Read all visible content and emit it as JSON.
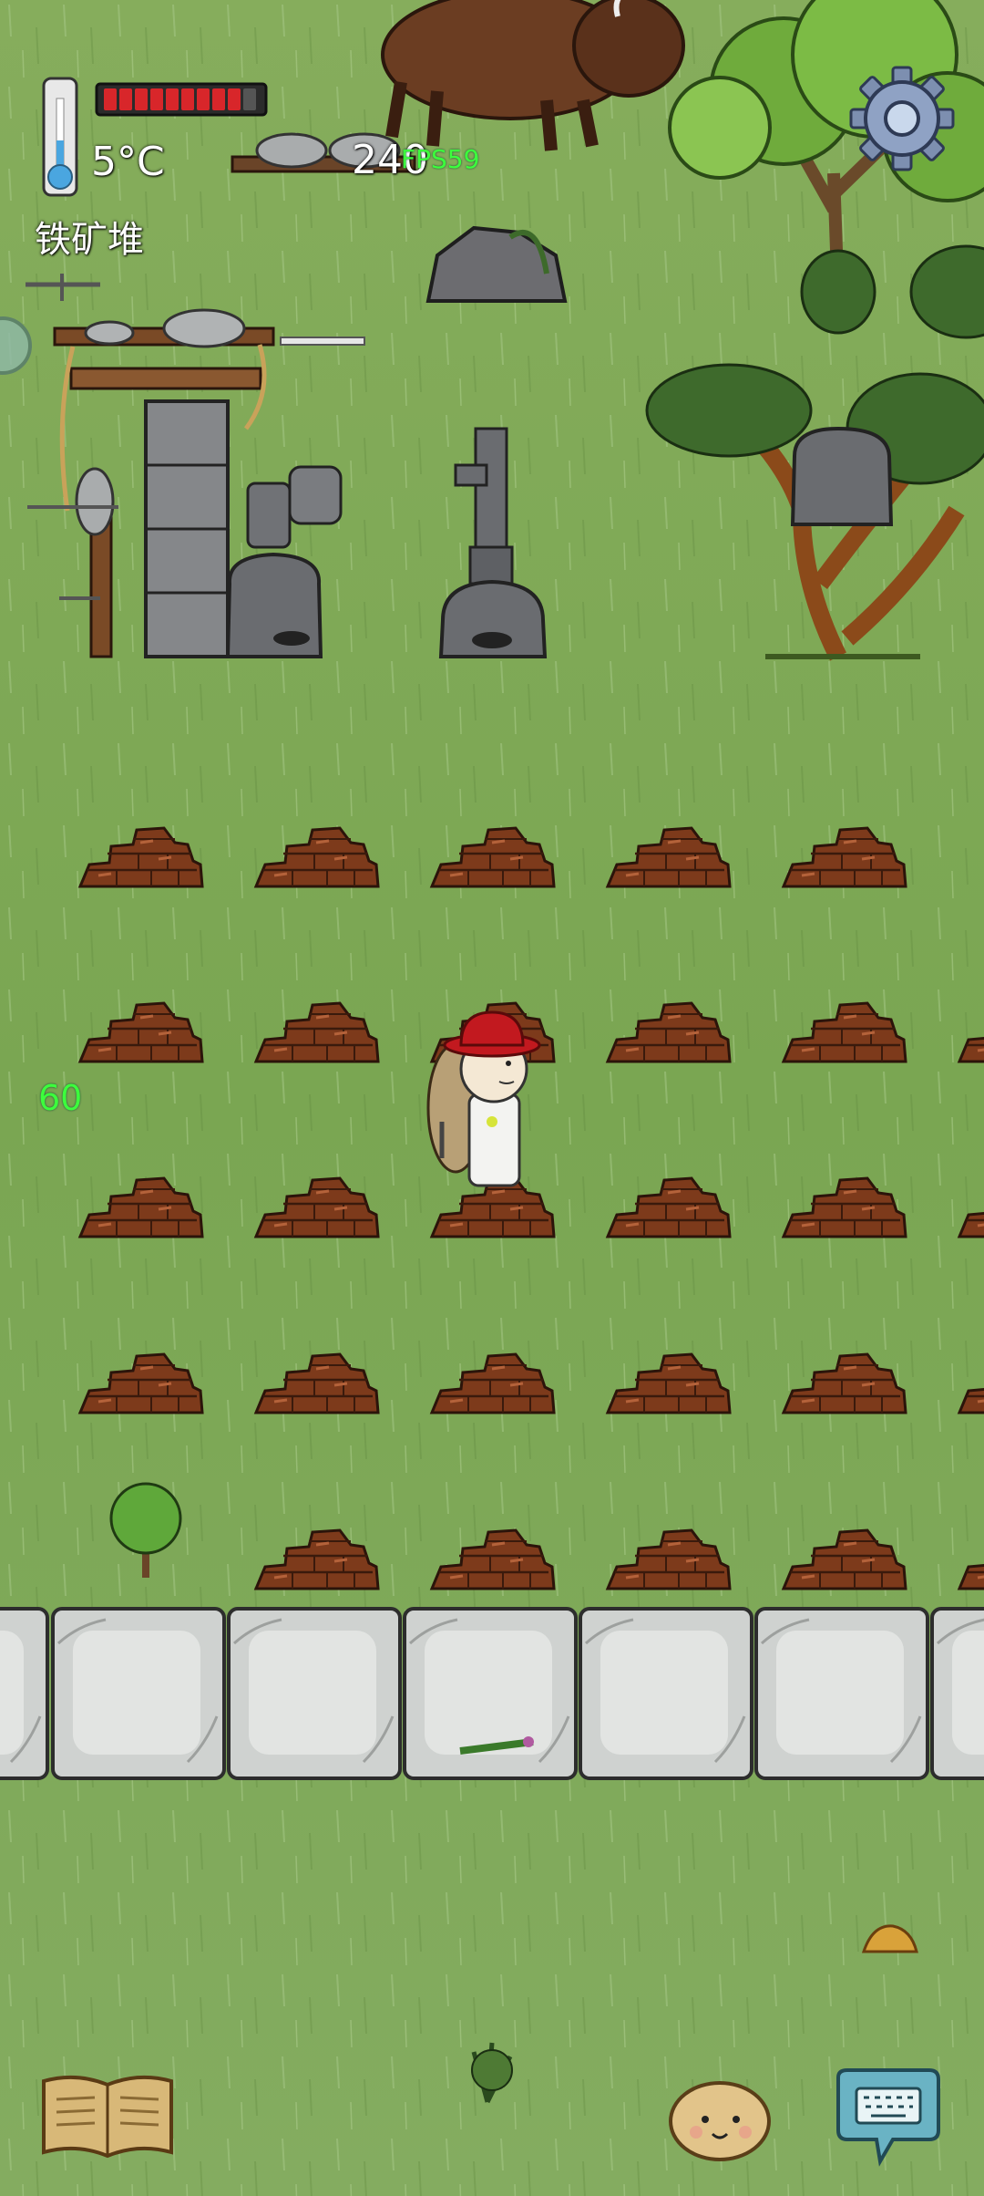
{
  "hud": {
    "temperature": "5°C",
    "heat_level": 0.85,
    "object_label": "铁矿堆",
    "age": "240",
    "fps": "FPS59",
    "food_timer": "60"
  },
  "icons": {
    "settings": "gear-icon",
    "thermometer": "thermometer-icon",
    "tech_book": "open-book-icon",
    "emote": "potato-face-icon",
    "chat": "keyboard-speech-bubble-icon"
  },
  "colors": {
    "grass": "#7fa857",
    "heat_bar": "#d8262a",
    "stone_floor": "#c9cccb",
    "iron_ore": "#8a3f1e",
    "hat": "#c2191f",
    "fps_text": "#3cff3c"
  }
}
